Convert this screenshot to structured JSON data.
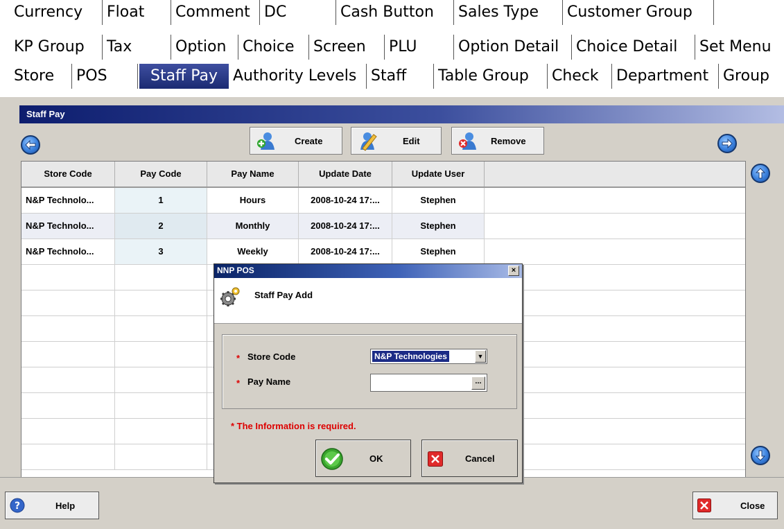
{
  "tabs": {
    "row1": [
      "Currency",
      "Float",
      "Comment",
      "DC",
      "Cash Button",
      "Sales Type",
      "Customer Group"
    ],
    "row2": [
      "KP Group",
      "Tax",
      "Option",
      "Choice",
      "Screen",
      "PLU",
      "Option Detail",
      "Choice Detail",
      "Set Menu"
    ],
    "row3": [
      "Store",
      "POS",
      "Staff Pay",
      "Authority Levels",
      "Staff",
      "Table Group",
      "Check",
      "Department",
      "Group"
    ],
    "active": "Staff Pay"
  },
  "panel": {
    "title": "Staff Pay",
    "toolbar": {
      "create_label": "Create",
      "edit_label": "Edit",
      "remove_label": "Remove"
    }
  },
  "table": {
    "columns": [
      "Store Code",
      "Pay Code",
      "Pay Name",
      "Update Date",
      "Update User"
    ],
    "rows": [
      [
        "N&P Technolo...",
        "1",
        "Hours",
        "2008-10-24 17:...",
        "Stephen"
      ],
      [
        "N&P Technolo...",
        "2",
        "Monthly",
        "2008-10-24 17:...",
        "Stephen"
      ],
      [
        "N&P Technolo...",
        "3",
        "Weekly",
        "2008-10-24 17:...",
        "Stephen"
      ]
    ]
  },
  "bottom": {
    "help_label": "Help",
    "close_label": "Close"
  },
  "dialog": {
    "title": "NNP POS",
    "close_glyph": "×",
    "subtitle": "Staff Pay Add",
    "required_mark": "*",
    "store_code_label": "Store Code",
    "store_code_value": "N&P Technologies",
    "pay_name_label": "Pay Name",
    "pay_name_value": "",
    "ellipsis_label": "...",
    "required_note": "* The Information is required.",
    "ok_label": "OK",
    "cancel_label": "Cancel"
  },
  "colors": {
    "active_tab": "#1b2a72",
    "title_bar": "#0d1d6e",
    "required": "#dd0000",
    "ok_green": "#3aa52e",
    "cancel_red": "#e02a2a"
  },
  "icons": [
    "left-arrow-icon",
    "right-arrow-icon",
    "up-arrow-icon",
    "down-arrow-icon",
    "create-user-icon",
    "edit-user-icon",
    "remove-user-icon",
    "gear-icon",
    "help-icon",
    "close-icon",
    "ok-check-icon",
    "cancel-x-icon"
  ]
}
